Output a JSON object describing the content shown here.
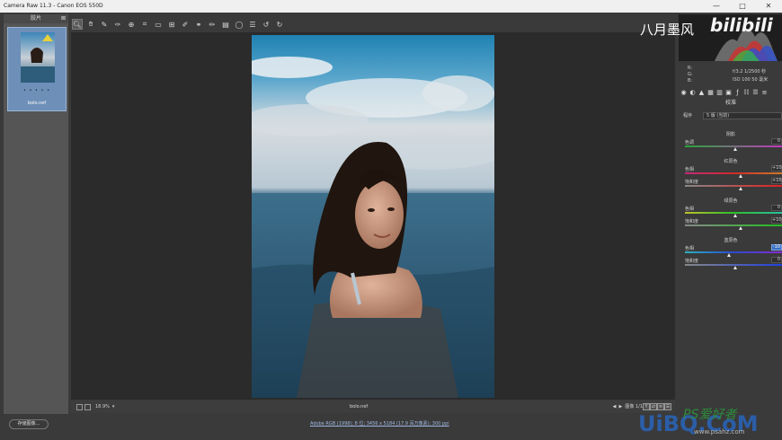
{
  "window": {
    "title": "Camera Raw 11.3 -  Canon EOS 550D",
    "minimize": "—",
    "maximize": "□",
    "close": "✕"
  },
  "toolbar": {
    "tools": [
      "zoom-icon",
      "hand-icon",
      "white-balance-icon",
      "color-sampler-icon",
      "targeted-adjust-icon",
      "crop-icon",
      "straighten-icon",
      "transform-icon",
      "spot-removal-icon",
      "red-eye-icon",
      "adjustment-brush-icon",
      "graduated-filter-icon",
      "radial-filter-icon",
      "preferences-icon",
      "rotate-ccw-icon",
      "rotate-cw-icon"
    ]
  },
  "filmstrip": {
    "header": "胶片",
    "thumbnail_name": "bolo.nef",
    "stars": "• • • • •"
  },
  "image": {
    "filename": "bolo.nef",
    "zoom": "18.9%"
  },
  "nav": {
    "page": "图像 1/1"
  },
  "status": {
    "save_label": "存储图像...",
    "workflow": "Adobe RGB (1998); 8 位; 3456 x 5184 (17.9 百万像素); 300 ppi"
  },
  "info": {
    "r": "R:",
    "g": "G:",
    "b": "B:",
    "aperture_shutter": "f/3.2   1/2500 秒",
    "iso_focal": "ISO 100   50 毫米"
  },
  "panel": {
    "title": "校准",
    "preset_label": "程序",
    "preset_value": "5 版 (当前)",
    "shadows_title": "阴影",
    "shadows_tint_label": "色调",
    "shadows_tint_value": "0",
    "red_title": "红原色",
    "red_hue_label": "色相",
    "red_hue_value": "+10",
    "red_sat_label": "饱和度",
    "red_sat_value": "+10",
    "green_title": "绿原色",
    "green_hue_label": "色相",
    "green_hue_value": "0",
    "green_sat_label": "饱和度",
    "green_sat_value": "+10",
    "blue_title": "蓝原色",
    "blue_hue_label": "色相",
    "blue_hue_value": "-10",
    "blue_sat_label": "饱和度",
    "blue_sat_value": "0"
  },
  "watermarks": {
    "channel": "八月墨风",
    "bili": "bilibili",
    "uibo": "UiBQ.CoM",
    "ps": "PS爱好者",
    "site": "www.psahz.com"
  }
}
